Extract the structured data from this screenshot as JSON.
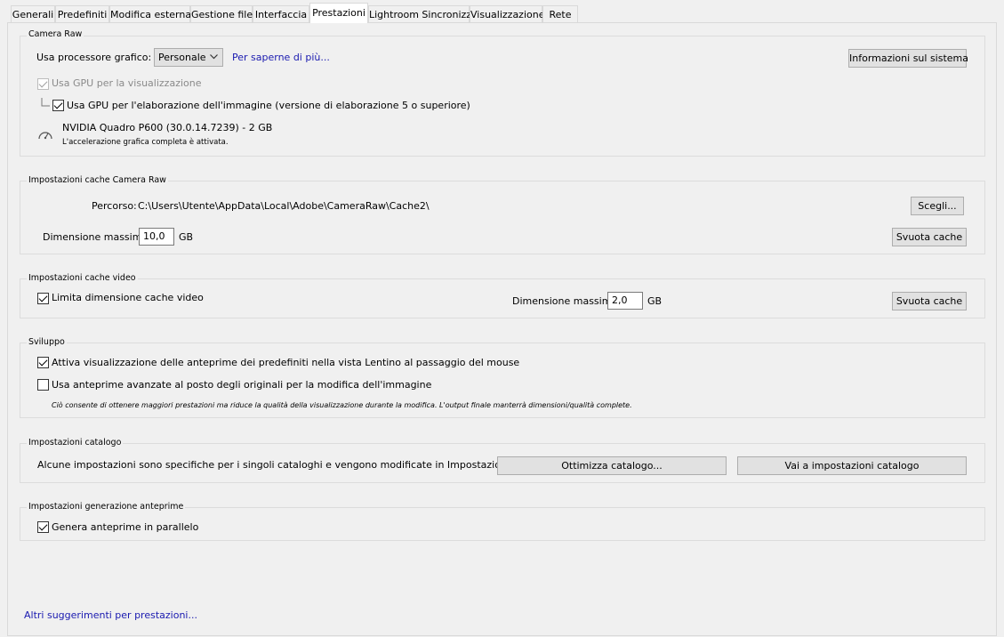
{
  "tabs": [
    {
      "label": "Generali"
    },
    {
      "label": "Predefiniti"
    },
    {
      "label": "Modifica esterna"
    },
    {
      "label": "Gestione file"
    },
    {
      "label": "Interfaccia"
    },
    {
      "label": "Prestazioni",
      "active": true
    },
    {
      "label": "Lightroom Sincronizza"
    },
    {
      "label": "Visualizzazione"
    },
    {
      "label": "Rete"
    }
  ],
  "camera_raw": {
    "title": "Camera Raw",
    "gpu_label": "Usa processore grafico:",
    "gpu_value": "Personale",
    "learn_more": "Per saperne di più...",
    "sysinfo_button": "Informazioni sul sistema",
    "gpu_display_label": "Usa GPU per la visualizzazione",
    "gpu_processing_label": "Usa GPU per l'elaborazione dell'immagine (versione di elaborazione 5 o superiore)",
    "gpu_name": "NVIDIA Quadro P600 (30.0.14.7239) - 2 GB",
    "gpu_status": "L'accelerazione grafica completa è attivata."
  },
  "cache_camera_raw": {
    "title": "Impostazioni cache Camera Raw",
    "path_label": "Percorso:",
    "path_value": "C:\\Users\\Utente\\AppData\\Local\\Adobe\\CameraRaw\\Cache2\\",
    "choose_button": "Scegli...",
    "max_label": "Dimensione massima:",
    "max_value": "10,0",
    "unit": "GB",
    "purge_button": "Svuota cache"
  },
  "cache_video": {
    "title": "Impostazioni cache video",
    "limit_label": "Limita dimensione cache video",
    "max_label": "Dimensione massima:",
    "max_value": "2,0",
    "unit": "GB",
    "purge_button": "Svuota cache"
  },
  "develop": {
    "title": "Sviluppo",
    "preview_hover_label": "Attiva visualizzazione delle anteprime dei predefiniti nella vista Lentino al passaggio del mouse",
    "smart_preview_label": "Usa anteprime avanzate al posto degli originali per la modifica dell'immagine",
    "note": "Ciò consente di ottenere maggiori prestazioni ma riduce la qualità della visualizzazione durante la modifica. L'output finale manterrà dimensioni/qualità complete."
  },
  "catalog": {
    "title": "Impostazioni catalogo",
    "desc": "Alcune impostazioni sono specifiche per i singoli cataloghi e vengono modificate in Impostazioni catalogo.",
    "optimize_button": "Ottimizza catalogo...",
    "goto_button": "Vai a impostazioni catalogo"
  },
  "preview_gen": {
    "title": "Impostazioni generazione anteprime",
    "parallel_label": "Genera anteprime in parallelo"
  },
  "footer": {
    "more_tips": "Altri suggerimenti per prestazioni..."
  }
}
